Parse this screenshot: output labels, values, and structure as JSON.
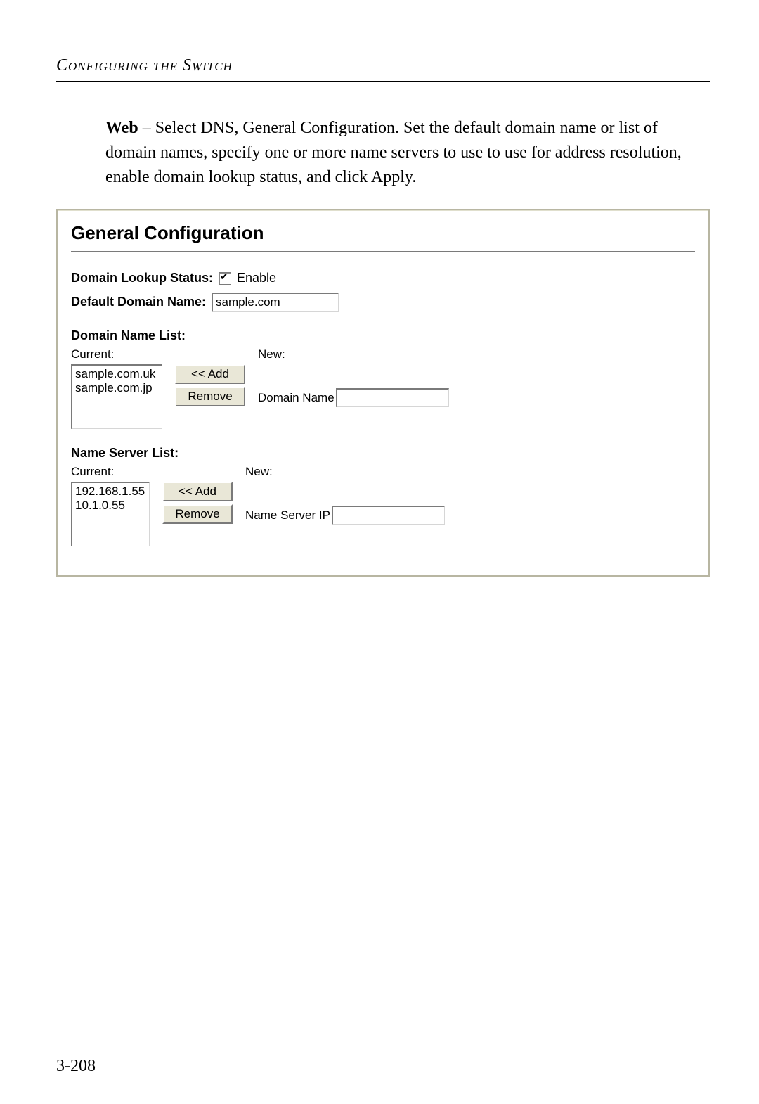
{
  "header": {
    "section_title": "Configuring the Switch"
  },
  "instructions": {
    "lead_bold": "Web",
    "body": " – Select DNS, General Configuration. Set the default domain name or list of domain names, specify one or more name servers to use to use for address resolution, enable domain lookup status, and click Apply."
  },
  "panel": {
    "title": "General Configuration",
    "domain_lookup": {
      "label": "Domain Lookup Status:",
      "enable_label": "Enable",
      "checked": true
    },
    "default_domain": {
      "label": "Default Domain Name:",
      "value": "sample.com"
    },
    "domain_list": {
      "section_label": "Domain Name List:",
      "current_label": "Current:",
      "new_label": "New:",
      "items": [
        "sample.com.uk",
        "sample.com.jp"
      ],
      "add_button": "<< Add",
      "remove_button": "Remove",
      "input_label": "Domain Name",
      "input_value": ""
    },
    "ns_list": {
      "section_label": "Name Server List:",
      "current_label": "Current:",
      "new_label": "New:",
      "items": [
        "192.168.1.55",
        "10.1.0.55"
      ],
      "add_button": "<< Add",
      "remove_button": "Remove",
      "input_label": "Name Server IP",
      "input_value": ""
    }
  },
  "page_number": "3-208"
}
